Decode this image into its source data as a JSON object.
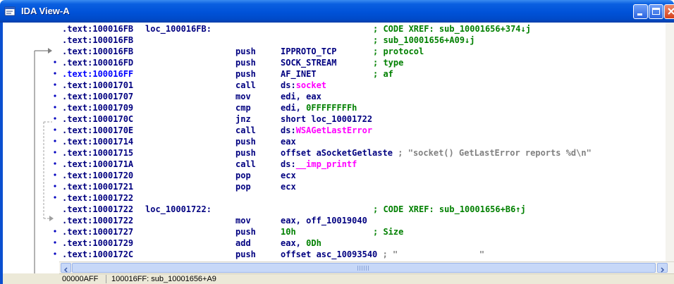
{
  "window": {
    "title": "IDA View-A",
    "icon": "ida-view-icon",
    "colors": {
      "titlebar": "#0a5fe0",
      "address": "#000080",
      "comment": "#008000",
      "import": "#ff00ff",
      "string": "#808080"
    }
  },
  "lines": [
    {
      "addr": ".text:100016FB",
      "label": "loc_100016FB:",
      "mnem": "",
      "ops": [],
      "comment": "; CODE XREF: sub_10001656+374↓j"
    },
    {
      "addr": ".text:100016FB",
      "label": "",
      "mnem": "",
      "ops": [],
      "comment": "; sub_10001656+A09↓j"
    },
    {
      "addr": ".text:100016FB",
      "label": "",
      "mnem": "push",
      "ops": [
        {
          "t": "IPPROTO_TCP",
          "c": "op"
        }
      ],
      "comment": "; protocol"
    },
    {
      "addr": ".text:100016FD",
      "label": "",
      "mnem": "push",
      "ops": [
        {
          "t": "SOCK_STREAM",
          "c": "op"
        }
      ],
      "comment": "; type"
    },
    {
      "addr": ".text:100016FF",
      "label": "",
      "mnem": "push",
      "ops": [
        {
          "t": "AF_INET",
          "c": "op"
        }
      ],
      "comment": "; af",
      "selected": true
    },
    {
      "addr": ".text:10001701",
      "label": "",
      "mnem": "call",
      "ops": [
        {
          "t": "ds:",
          "c": "op"
        },
        {
          "t": "socket",
          "c": "imp"
        }
      ],
      "comment": ""
    },
    {
      "addr": ".text:10001707",
      "label": "",
      "mnem": "mov",
      "ops": [
        {
          "t": "edi, eax",
          "c": "op"
        }
      ],
      "comment": ""
    },
    {
      "addr": ".text:10001709",
      "label": "",
      "mnem": "cmp",
      "ops": [
        {
          "t": "edi, ",
          "c": "op"
        },
        {
          "t": "0FFFFFFFFh",
          "c": "num"
        }
      ],
      "comment": ""
    },
    {
      "addr": ".text:1000170C",
      "label": "",
      "mnem": "jnz",
      "ops": [
        {
          "t": "short loc_10001722",
          "c": "op"
        }
      ],
      "comment": ""
    },
    {
      "addr": ".text:1000170E",
      "label": "",
      "mnem": "call",
      "ops": [
        {
          "t": "ds:",
          "c": "op"
        },
        {
          "t": "WSAGetLastError",
          "c": "imp"
        }
      ],
      "comment": ""
    },
    {
      "addr": ".text:10001714",
      "label": "",
      "mnem": "push",
      "ops": [
        {
          "t": "eax",
          "c": "op"
        }
      ],
      "comment": ""
    },
    {
      "addr": ".text:10001715",
      "label": "",
      "mnem": "push",
      "ops": [
        {
          "t": "offset aSocketGetlaste",
          "c": "op"
        }
      ],
      "comment": "; \"socket() GetLastError reports %d\\n\""
    },
    {
      "addr": ".text:1000171A",
      "label": "",
      "mnem": "call",
      "ops": [
        {
          "t": "ds:",
          "c": "op"
        },
        {
          "t": "__imp_printf",
          "c": "imp"
        }
      ],
      "comment": ""
    },
    {
      "addr": ".text:10001720",
      "label": "",
      "mnem": "pop",
      "ops": [
        {
          "t": "ecx",
          "c": "op"
        }
      ],
      "comment": ""
    },
    {
      "addr": ".text:10001721",
      "label": "",
      "mnem": "pop",
      "ops": [
        {
          "t": "ecx",
          "c": "op"
        }
      ],
      "comment": ""
    },
    {
      "addr": ".text:10001722",
      "label": "",
      "mnem": "",
      "ops": [],
      "comment": ""
    },
    {
      "addr": ".text:10001722",
      "label": "loc_10001722:",
      "mnem": "",
      "ops": [],
      "comment": "; CODE XREF: sub_10001656+B6↑j"
    },
    {
      "addr": ".text:10001722",
      "label": "",
      "mnem": "mov",
      "ops": [
        {
          "t": "eax, off_10019040",
          "c": "op"
        }
      ],
      "comment": ""
    },
    {
      "addr": ".text:10001727",
      "label": "",
      "mnem": "push",
      "ops": [
        {
          "t": "10h",
          "c": "num"
        }
      ],
      "comment": "; Size"
    },
    {
      "addr": ".text:10001729",
      "label": "",
      "mnem": "add",
      "ops": [
        {
          "t": "eax, ",
          "c": "op"
        },
        {
          "t": "0Dh",
          "c": "num"
        }
      ],
      "comment": ""
    },
    {
      "addr": ".text:1000172C",
      "label": "",
      "mnem": "push",
      "ops": [
        {
          "t": "offset asc_10093540",
          "c": "op"
        }
      ],
      "comment": "; \"                \""
    }
  ],
  "status": {
    "offset": "00000AFF",
    "location": "100016FF: sub_10001656+A9"
  }
}
